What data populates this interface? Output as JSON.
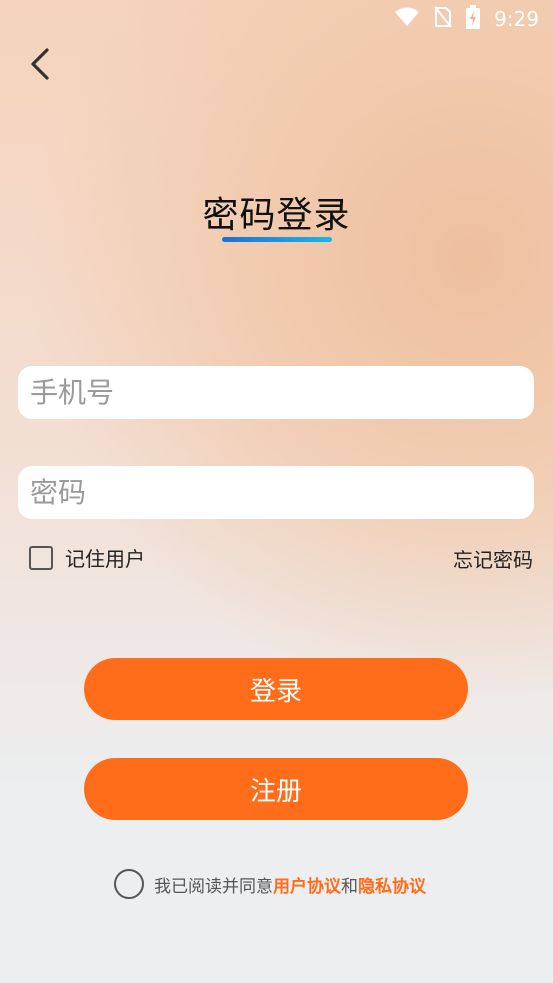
{
  "status_bar": {
    "time": "9:29"
  },
  "title": "密码登录",
  "phone_input": {
    "placeholder": "手机号",
    "value": ""
  },
  "password_input": {
    "placeholder": "密码",
    "value": ""
  },
  "remember_label": "记住用户",
  "forgot_label": "忘记密码",
  "login_label": "登录",
  "register_label": "注册",
  "agreement": {
    "prefix": "我已阅读并同意",
    "user_agreement": "用户协议",
    "conjunction": "和",
    "privacy_policy": "隐私协议"
  },
  "colors": {
    "accent": "#ff6d1a",
    "underline_start": "#1d6fd8",
    "underline_end": "#18b8e8"
  },
  "icons": [
    "wifi-icon",
    "no-sim-icon",
    "battery-charging-icon",
    "back-arrow-icon"
  ]
}
